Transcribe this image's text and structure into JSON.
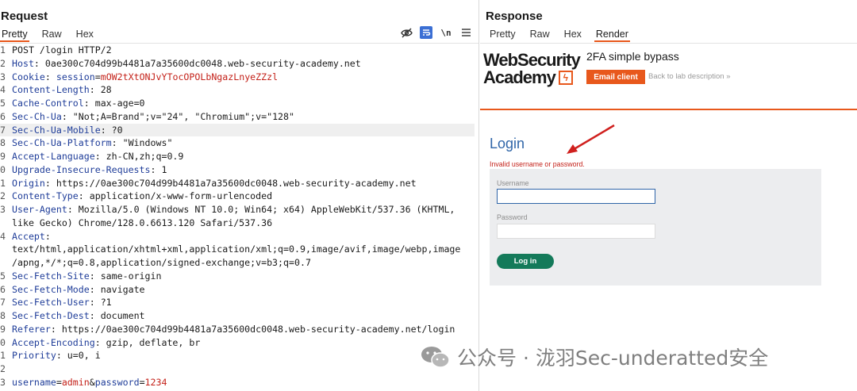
{
  "request": {
    "title": "Request",
    "tabs": [
      "Pretty",
      "Raw",
      "Hex"
    ],
    "toolbar": {
      "hide_icon": "eye-slash-icon",
      "wrap_icon": "wrap-icon",
      "newline_label": "\\n",
      "menu_icon": "menu-icon"
    },
    "lines": [
      {
        "n": "1",
        "parts": [
          [
            "v",
            "POST /login HTTP/2"
          ]
        ]
      },
      {
        "n": "2",
        "parts": [
          [
            "k",
            "Host"
          ],
          [
            "v",
            ": 0ae300c704d99b4481a7a35600dc0048.web-security-academy.net"
          ]
        ]
      },
      {
        "n": "3",
        "parts": [
          [
            "k",
            "Cookie"
          ],
          [
            "v",
            ": "
          ],
          [
            "k",
            "session"
          ],
          [
            "v",
            "="
          ],
          [
            "red",
            "mOW2tXtONJvYTocOPOLbNgazLnyeZZzl"
          ]
        ]
      },
      {
        "n": "4",
        "parts": [
          [
            "k",
            "Content-Length"
          ],
          [
            "v",
            ": 28"
          ]
        ]
      },
      {
        "n": "5",
        "parts": [
          [
            "k",
            "Cache-Control"
          ],
          [
            "v",
            ": max-age=0"
          ]
        ]
      },
      {
        "n": "6",
        "parts": [
          [
            "k",
            "Sec-Ch-Ua"
          ],
          [
            "v",
            ": \"Not;A=Brand\";v=\"24\", \"Chromium\";v=\"128\""
          ]
        ]
      },
      {
        "n": "7",
        "parts": [
          [
            "k",
            "Sec-Ch-Ua-Mobile"
          ],
          [
            "v",
            ": ?0"
          ]
        ],
        "hl": true
      },
      {
        "n": "8",
        "parts": [
          [
            "k",
            "Sec-Ch-Ua-Platform"
          ],
          [
            "v",
            ": \"Windows\""
          ]
        ]
      },
      {
        "n": "9",
        "parts": [
          [
            "k",
            "Accept-Language"
          ],
          [
            "v",
            ": zh-CN,zh;q=0.9"
          ]
        ]
      },
      {
        "n": "0",
        "parts": [
          [
            "k",
            "Upgrade-Insecure-Requests"
          ],
          [
            "v",
            ": 1"
          ]
        ]
      },
      {
        "n": "1",
        "parts": [
          [
            "k",
            "Origin"
          ],
          [
            "v",
            ": https://0ae300c704d99b4481a7a35600dc0048.web-security-academy.net"
          ]
        ]
      },
      {
        "n": "2",
        "parts": [
          [
            "k",
            "Content-Type"
          ],
          [
            "v",
            ": application/x-www-form-urlencoded"
          ]
        ]
      },
      {
        "n": "3",
        "parts": [
          [
            "k",
            "User-Agent"
          ],
          [
            "v",
            ": Mozilla/5.0 (Windows NT 10.0; Win64; x64) AppleWebKit/537.36 (KHTML,"
          ]
        ]
      },
      {
        "n": "",
        "parts": [
          [
            "v",
            "like Gecko) Chrome/128.0.6613.120 Safari/537.36"
          ]
        ]
      },
      {
        "n": "4",
        "parts": [
          [
            "k",
            "Accept"
          ],
          [
            "v",
            ":"
          ]
        ]
      },
      {
        "n": "",
        "parts": [
          [
            "v",
            "text/html,application/xhtml+xml,application/xml;q=0.9,image/avif,image/webp,image"
          ]
        ]
      },
      {
        "n": "",
        "parts": [
          [
            "v",
            "/apng,*/*;q=0.8,application/signed-exchange;v=b3;q=0.7"
          ]
        ]
      },
      {
        "n": "5",
        "parts": [
          [
            "k",
            "Sec-Fetch-Site"
          ],
          [
            "v",
            ": same-origin"
          ]
        ]
      },
      {
        "n": "6",
        "parts": [
          [
            "k",
            "Sec-Fetch-Mode"
          ],
          [
            "v",
            ": navigate"
          ]
        ]
      },
      {
        "n": "7",
        "parts": [
          [
            "k",
            "Sec-Fetch-User"
          ],
          [
            "v",
            ": ?1"
          ]
        ]
      },
      {
        "n": "8",
        "parts": [
          [
            "k",
            "Sec-Fetch-Dest"
          ],
          [
            "v",
            ": document"
          ]
        ]
      },
      {
        "n": "9",
        "parts": [
          [
            "k",
            "Referer"
          ],
          [
            "v",
            ": https://0ae300c704d99b4481a7a35600dc0048.web-security-academy.net/login"
          ]
        ]
      },
      {
        "n": "0",
        "parts": [
          [
            "k",
            "Accept-Encoding"
          ],
          [
            "v",
            ": gzip, deflate, br"
          ]
        ]
      },
      {
        "n": "1",
        "parts": [
          [
            "k",
            "Priority"
          ],
          [
            "v",
            ": u=0, i"
          ]
        ]
      },
      {
        "n": "2",
        "parts": []
      },
      {
        "n": "3",
        "parts": [
          [
            "k",
            "username"
          ],
          [
            "v",
            "="
          ],
          [
            "red",
            "admin"
          ],
          [
            "v",
            "&"
          ],
          [
            "k",
            "password"
          ],
          [
            "v",
            "="
          ],
          [
            "red",
            "1234"
          ]
        ]
      }
    ]
  },
  "response": {
    "title": "Response",
    "tabs": [
      "Pretty",
      "Raw",
      "Hex",
      "Render"
    ],
    "active_tab": "Render",
    "logo_line1": "WebSecurity",
    "logo_line2": "Academy",
    "lab_title": "2FA simple bypass",
    "lab_badge": "Email client",
    "back_link": "Back to lab description",
    "back_link_icon": "double-chevron-right-icon",
    "login_heading": "Login",
    "error_message": "Invalid username or password.",
    "username_label": "Username",
    "password_label": "Password",
    "username_value": "",
    "password_value": "",
    "login_button": "Log in"
  },
  "colors": {
    "accent": "#e8581c",
    "header_key": "#1f3d99",
    "value_red": "#c4221a",
    "login_blue": "#2f65a8",
    "button_green": "#147a5a"
  },
  "watermark": "公众号 · 泷羽Sec-underatted安全"
}
